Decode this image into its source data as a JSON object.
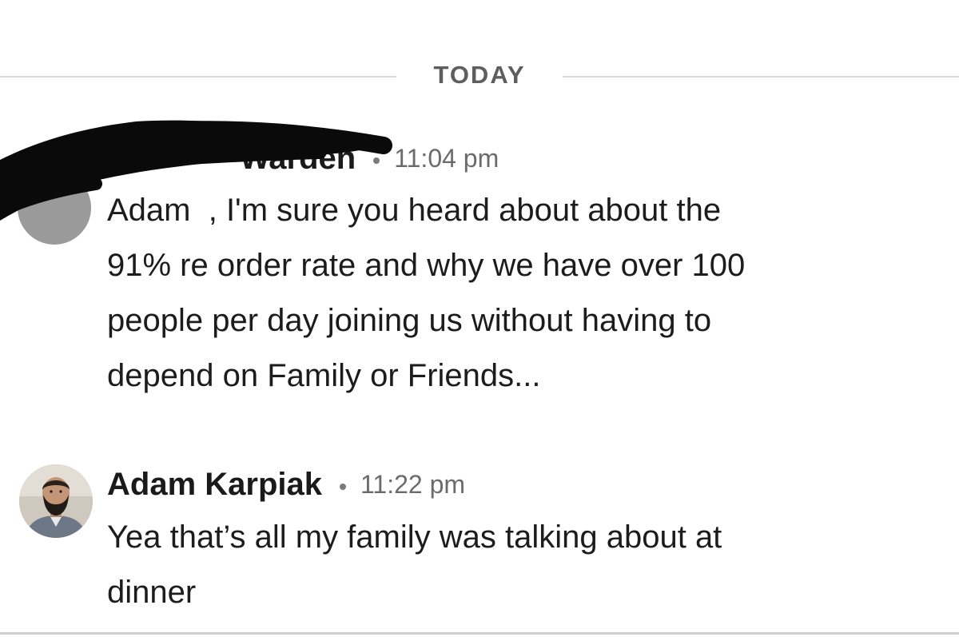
{
  "divider": {
    "label": "TODAY"
  },
  "messages": [
    {
      "sender": "",
      "time": "11:04 pm",
      "lines": [
        "Adam  , I'm sure you heard about about the",
        "91% re order rate and why we have over 100",
        "people per day joining us without having to",
        "depend on Family or Friends..."
      ]
    },
    {
      "sender": "Adam Karpiak",
      "time": "11:22 pm",
      "lines": [
        "Yea that’s all my family was talking about at",
        "dinner"
      ]
    }
  ],
  "colors": {
    "divider_line": "#d7d7d7",
    "divider_label": "#5e5e5e",
    "timestamp": "#6b6b6b",
    "redaction": "#0a0a0a"
  },
  "icons": {
    "separator": "bullet-dot-icon",
    "avatar": "user-avatar-photo"
  }
}
